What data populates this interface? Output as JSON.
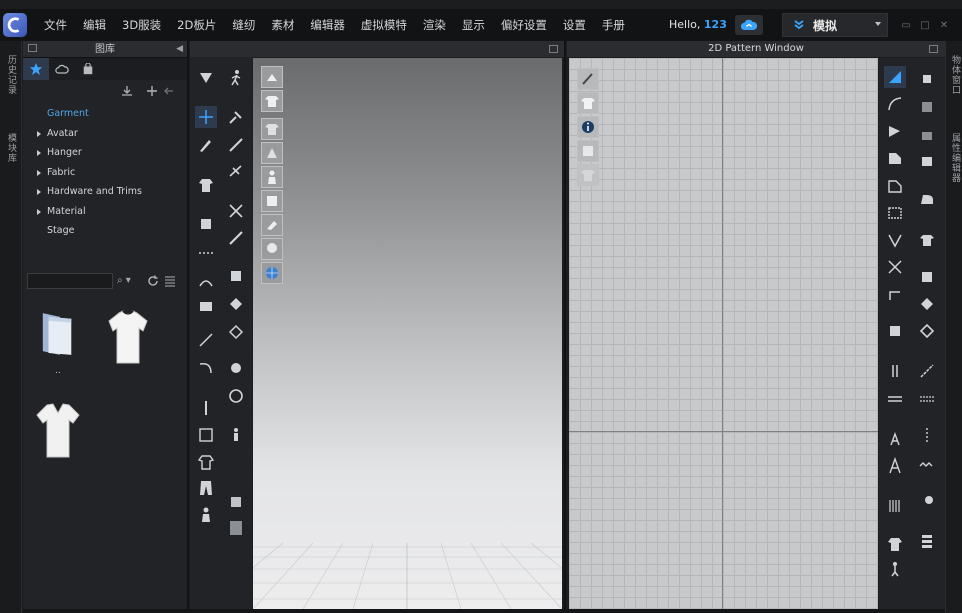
{
  "menubar": {
    "items": [
      "文件",
      "编辑",
      "3D服装",
      "2D板片",
      "缝纫",
      "素材",
      "编辑器",
      "虚拟模特",
      "渲染",
      "显示",
      "偏好设置",
      "设置",
      "手册"
    ],
    "hello_text": "Hello,",
    "user": "123",
    "mode_label": "模拟",
    "mode_icon": "double-chevron-down-icon"
  },
  "left_strip": {
    "tab1": "历史记录",
    "tab2": "模块库"
  },
  "right_strip": {
    "tab1": "物体窗口",
    "tab2": "属性编辑器"
  },
  "library": {
    "title": "图库",
    "tabs": [
      "star-icon",
      "cloud-icon",
      "bag-icon"
    ],
    "tree_root": "Garment",
    "tree_items": [
      "Avatar",
      "Hanger",
      "Fabric",
      "Hardware and Trims",
      "Material"
    ],
    "tree_stage": "Stage",
    "search_value": "",
    "thumbs": [
      {
        "label": "..",
        "icon": "folder-icon"
      },
      {
        "label": "",
        "icon": "tshirt-icon"
      },
      {
        "label": "",
        "icon": "vneck-shirt-icon"
      }
    ]
  },
  "pattern_window": {
    "title": "2D Pattern Window"
  },
  "colors": {
    "accent": "#3aa4ff",
    "active_tab": "#2f3a4c",
    "panel_bg": "#222326"
  }
}
